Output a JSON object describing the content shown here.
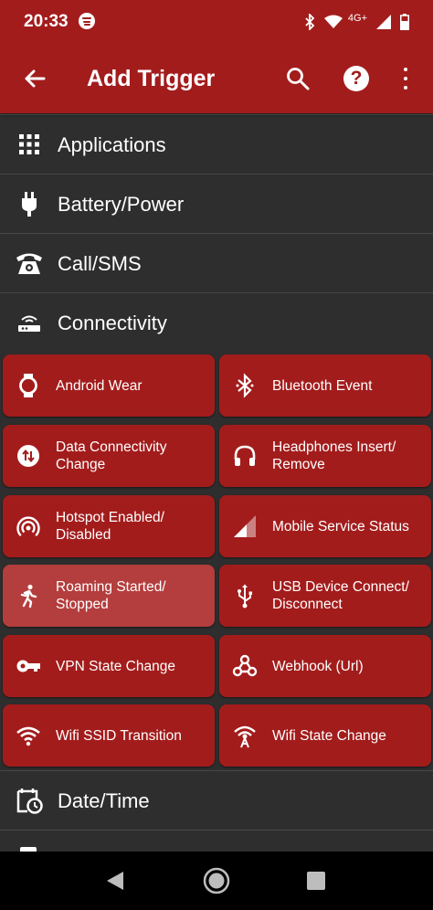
{
  "status": {
    "time": "20:33",
    "network": "4G+"
  },
  "appbar": {
    "title": "Add Trigger"
  },
  "sections": [
    {
      "label": "Applications"
    },
    {
      "label": "Battery/Power"
    },
    {
      "label": "Call/SMS"
    },
    {
      "label": "Connectivity"
    },
    {
      "label": "Date/Time"
    }
  ],
  "connectivity_items": [
    {
      "label": "Android Wear",
      "icon": "watch-icon"
    },
    {
      "label": "Bluetooth Event",
      "icon": "bluetooth-icon"
    },
    {
      "label": "Data Connectivity Change",
      "icon": "data-swap-icon"
    },
    {
      "label": "Headphones Insert/ Remove",
      "icon": "headphones-icon"
    },
    {
      "label": "Hotspot Enabled/ Disabled",
      "icon": "hotspot-icon"
    },
    {
      "label": "Mobile Service Status",
      "icon": "signal-icon"
    },
    {
      "label": "Roaming Started/ Stopped",
      "icon": "running-person-icon"
    },
    {
      "label": "USB Device Connect/ Disconnect",
      "icon": "usb-icon"
    },
    {
      "label": "VPN State Change",
      "icon": "key-icon"
    },
    {
      "label": "Webhook (Url)",
      "icon": "webhook-icon"
    },
    {
      "label": "Wifi SSID Transition",
      "icon": "wifi-icon"
    },
    {
      "label": "Wifi State Change",
      "icon": "wifi-tower-icon"
    }
  ],
  "colors": {
    "accent": "#a31c1c",
    "background": "#2e2e2e",
    "selected": "#b43d3d"
  }
}
